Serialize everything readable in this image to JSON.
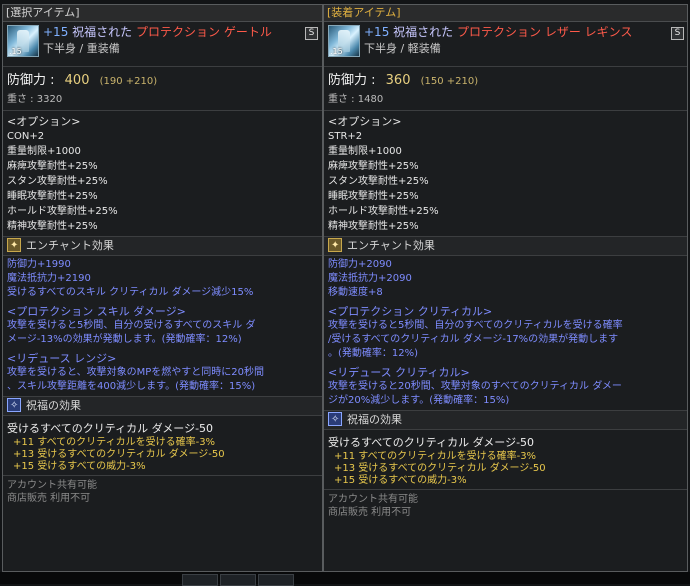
{
  "left": {
    "header": "[選択アイテム]",
    "item": {
      "level_badge": ".15",
      "plus": "+15",
      "blessed": "祝福された",
      "name": "プロテクション ゲートル",
      "type": "下半身 / 重装備",
      "badge": "S"
    },
    "defense": {
      "label": "防御力 :",
      "value": "400",
      "extra": "(190 +210)"
    },
    "weight": "重さ : 3320",
    "options": {
      "title": "<オプション>",
      "lines": [
        "CON+2",
        "重量制限+1000",
        "麻痺攻撃耐性+25%",
        "スタン攻撃耐性+25%",
        "睡眠攻撃耐性+25%",
        "ホールド攻撃耐性+25%",
        "精神攻撃耐性+25%"
      ]
    },
    "enchant": {
      "title": "エンチャント効果",
      "lines": [
        "防御力+1990",
        "魔法抵抗力+2190",
        "受けるすべてのスキル クリティカル ダメージ減少15%"
      ],
      "sub1_title": "<プロテクション スキル ダメージ>",
      "sub1_lines": [
        "攻撃を受けると5秒間、自分の受けるすべてのスキル ダ",
        "メージ-13%の効果が発動します。(発動確率：12%)"
      ],
      "sub2_title": "<リデュース レンジ>",
      "sub2_lines": [
        "攻撃を受けると、攻撃対象のMPを燃やすと同時に20秒間",
        "、スキル攻撃距離を400減少します。(発動確率：15%)"
      ]
    },
    "blessing": {
      "title": "祝福の効果",
      "main": "受けるすべてのクリティカル ダメージ-50",
      "lines": [
        "+11 すべてのクリティカルを受ける確率-3%",
        "+13 受けるすべてのクリティカル ダメージ-50",
        "+15 受けるすべての威力-3%"
      ]
    },
    "footer": [
      "アカウント共有可能",
      "商店販売 利用不可"
    ]
  },
  "right": {
    "header": "[装着アイテム]",
    "item": {
      "level_badge": ".15",
      "plus": "+15",
      "blessed": "祝福された",
      "name": "プロテクション レザー レギンス",
      "type": "下半身 / 軽装備",
      "badge": "S"
    },
    "defense": {
      "label": "防御力 :",
      "value": "360",
      "extra": "(150 +210)"
    },
    "weight": "重さ : 1480",
    "options": {
      "title": "<オプション>",
      "lines": [
        "STR+2",
        "重量制限+1000",
        "麻痺攻撃耐性+25%",
        "スタン攻撃耐性+25%",
        "睡眠攻撃耐性+25%",
        "ホールド攻撃耐性+25%",
        "精神攻撃耐性+25%"
      ]
    },
    "enchant": {
      "title": "エンチャント効果",
      "lines": [
        "防御力+2090",
        "魔法抵抗力+2090",
        "移動速度+8"
      ],
      "sub1_title": "<プロテクション クリティカル>",
      "sub1_lines": [
        "攻撃を受けると5秒間、自分のすべてのクリティカルを受ける確率",
        "/受けるすべてのクリティカル ダメージ-17%の効果が発動します",
        "。(発動確率：12%)"
      ],
      "sub2_title": "<リデュース クリティカル>",
      "sub2_lines": [
        "攻撃を受けると20秒間、攻撃対象のすべてのクリティカル ダメー",
        "ジが20%減少します。(発動確率：15%)"
      ]
    },
    "blessing": {
      "title": "祝福の効果",
      "main": "受けるすべてのクリティカル ダメージ-50",
      "lines": [
        "+11 すべてのクリティカルを受ける確率-3%",
        "+13 受けるすべてのクリティカル ダメージ-50",
        "+15 受けるすべての威力-3%"
      ]
    },
    "footer": [
      "アカウント共有可能",
      "商店販売 利用不可"
    ]
  },
  "colors": {
    "panel_bg": "#1b1d1f",
    "header_selected": "#d2d2d2",
    "header_equipped": "#e0b040",
    "item_name_red": "#ff5a4a",
    "enchant_blue": "#7e8cff",
    "blessing_gold": "#e8c84c",
    "footer_gray": "#8a8a8a"
  },
  "icons": {
    "item": "leg-armor-icon",
    "enchant": "enchant-icon",
    "blessing": "blessing-icon"
  }
}
